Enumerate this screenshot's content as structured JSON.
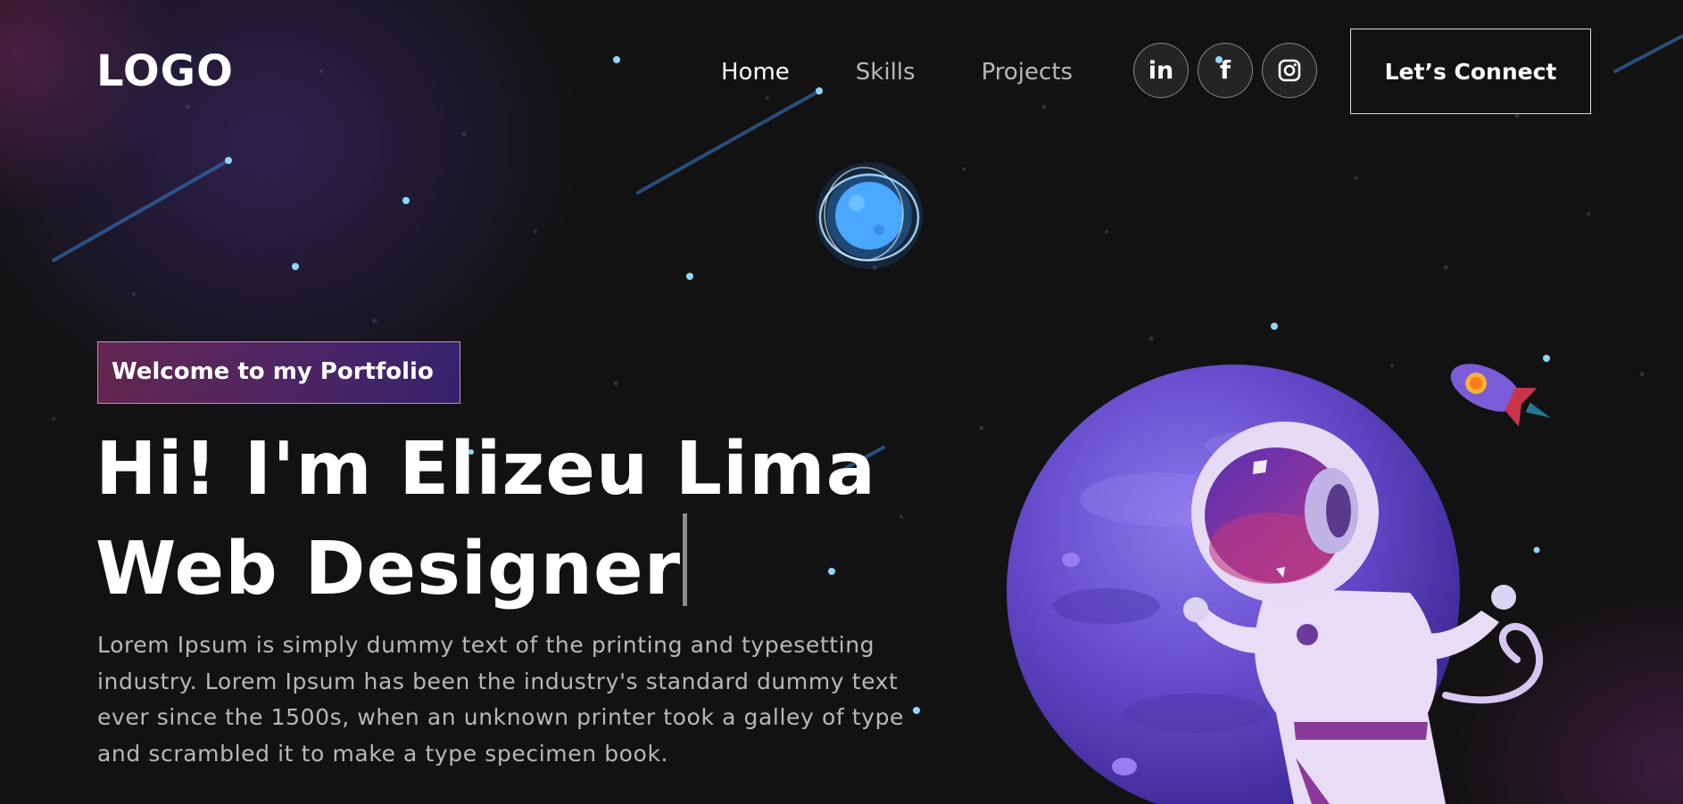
{
  "navbar": {
    "logo": "LOGO",
    "links": [
      {
        "label": "Home",
        "active": true
      },
      {
        "label": "Skills",
        "active": false
      },
      {
        "label": "Projects",
        "active": false
      }
    ],
    "social": [
      {
        "icon": "linkedin-icon",
        "glyph": "in"
      },
      {
        "icon": "facebook-icon",
        "glyph": "f"
      },
      {
        "icon": "instagram-icon"
      }
    ],
    "connect_label": "Let’s Connect"
  },
  "hero": {
    "tagline": "Welcome to my Portfolio",
    "headline_line1": "Hi! I'm Elizeu Lima",
    "headline_line2": "Web Designer",
    "description": "Lorem Ipsum is simply dummy text of the printing and typesetting industry. Lorem Ipsum has been the industry's standard dummy text ever since the 1500s, when an unknown printer took a galley of type and scrambled it to make a type specimen book."
  },
  "colors": {
    "background": "#121212",
    "accent_pink": "#AA367C",
    "accent_purple": "#4A2FBD",
    "text_muted": "#B8B8B8"
  }
}
